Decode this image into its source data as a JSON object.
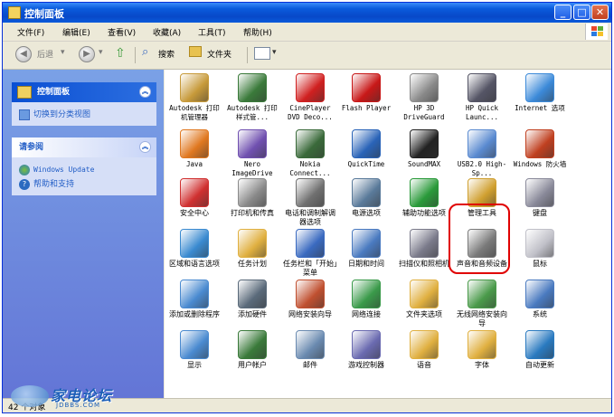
{
  "window": {
    "title": "控制面板"
  },
  "menu": [
    "文件(F)",
    "编辑(E)",
    "查看(V)",
    "收藏(A)",
    "工具(T)",
    "帮助(H)"
  ],
  "toolbar": {
    "back": "后退",
    "search": "搜索",
    "folders": "文件夹"
  },
  "sidebar": {
    "panel1": {
      "title": "控制面板",
      "link": "切换到分类视图"
    },
    "panel2": {
      "title": "请参阅",
      "links": [
        "Windows Update",
        "帮助和支持"
      ]
    }
  },
  "items": [
    {
      "label": "Autodesk 打印机管理器",
      "icon": "printer-manager-icon",
      "color": "#c79a3a"
    },
    {
      "label": "Autodesk 打印样式管...",
      "icon": "plot-style-icon",
      "color": "#3a7a3a"
    },
    {
      "label": "CinePlayer DVD Deco...",
      "icon": "cineplayer-icon",
      "color": "#d02020"
    },
    {
      "label": "Flash Player",
      "icon": "flash-icon",
      "color": "#c81818"
    },
    {
      "label": "HP 3D DriveGuard",
      "icon": "drive-icon",
      "color": "#8a8a8a"
    },
    {
      "label": "HP Quick Launc...",
      "icon": "rocket-icon",
      "color": "#555566"
    },
    {
      "label": "Internet 选项",
      "icon": "internet-options-icon",
      "color": "#3c8ad9"
    },
    {
      "label": "Java",
      "icon": "java-icon",
      "color": "#e07820"
    },
    {
      "label": "Nero ImageDrive",
      "icon": "nero-icon",
      "color": "#7050b0"
    },
    {
      "label": "Nokia Connect...",
      "icon": "nokia-icon",
      "color": "#3a6a3a"
    },
    {
      "label": "QuickTime",
      "icon": "quicktime-icon",
      "color": "#2a64b8"
    },
    {
      "label": "SoundMAX",
      "icon": "soundmax-icon",
      "color": "#222222"
    },
    {
      "label": "USB2.0 High-Sp...",
      "icon": "usb-icon",
      "color": "#5a8ad0"
    },
    {
      "label": "Windows 防火墙",
      "icon": "firewall-icon",
      "color": "#c04020"
    },
    {
      "label": "安全中心",
      "icon": "security-center-icon",
      "color": "#d03030"
    },
    {
      "label": "打印机和传真",
      "icon": "printer-fax-icon",
      "color": "#8a8a8a"
    },
    {
      "label": "电话和调制解调器选项",
      "icon": "phone-modem-icon",
      "color": "#707070"
    },
    {
      "label": "电源选项",
      "icon": "power-icon",
      "color": "#5a7a9a"
    },
    {
      "label": "辅助功能选项",
      "icon": "accessibility-icon",
      "color": "#2a9a3a"
    },
    {
      "label": "管理工具",
      "icon": "admin-tools-icon",
      "color": "#d0a030"
    },
    {
      "label": "键盘",
      "icon": "keyboard-icon",
      "color": "#8a8a9a"
    },
    {
      "label": "区域和语言选项",
      "icon": "region-language-icon",
      "color": "#3a8ad0"
    },
    {
      "label": "任务计划",
      "icon": "scheduled-tasks-icon",
      "color": "#e0b040"
    },
    {
      "label": "任务栏和「开始」菜单",
      "icon": "taskbar-icon",
      "color": "#3a6ac0"
    },
    {
      "label": "日期和时间",
      "icon": "clock-icon",
      "color": "#4a7ac0"
    },
    {
      "label": "扫描仪和照相机",
      "icon": "scanner-camera-icon",
      "color": "#7a7a8a"
    },
    {
      "label": "声音和音频设备",
      "icon": "speaker-icon",
      "color": "#7a7a7a"
    },
    {
      "label": "鼠标",
      "icon": "mouse-icon",
      "color": "#c0c0c8"
    },
    {
      "label": "添加或删除程序",
      "icon": "add-remove-programs-icon",
      "color": "#4a8ad0"
    },
    {
      "label": "添加硬件",
      "icon": "add-hardware-icon",
      "color": "#5a6a7a"
    },
    {
      "label": "网络安装向导",
      "icon": "network-setup-icon",
      "color": "#c05030"
    },
    {
      "label": "网络连接",
      "icon": "network-connections-icon",
      "color": "#3a9a4a"
    },
    {
      "label": "文件夹选项",
      "icon": "folder-options-icon",
      "color": "#e0b040"
    },
    {
      "label": "无线网络安装向导",
      "icon": "wireless-icon",
      "color": "#4a9a4a"
    },
    {
      "label": "系统",
      "icon": "system-icon",
      "color": "#4a7ac0"
    },
    {
      "label": "显示",
      "icon": "display-icon",
      "color": "#4a8ad0"
    },
    {
      "label": "用户帐户",
      "icon": "user-accounts-icon",
      "color": "#3a7a3a"
    },
    {
      "label": "邮件",
      "icon": "mail-icon",
      "color": "#6a8ab0"
    },
    {
      "label": "游戏控制器",
      "icon": "game-controller-icon",
      "color": "#6a6ab0"
    },
    {
      "label": "语音",
      "icon": "speech-icon",
      "color": "#e0b040"
    },
    {
      "label": "字体",
      "icon": "fonts-icon",
      "color": "#e0b040"
    },
    {
      "label": "自动更新",
      "icon": "auto-update-icon",
      "color": "#2a7ac0"
    }
  ],
  "status": {
    "count": "42 个对象"
  },
  "watermark": {
    "name": "家电论坛",
    "site": "JDBBS.COM"
  }
}
